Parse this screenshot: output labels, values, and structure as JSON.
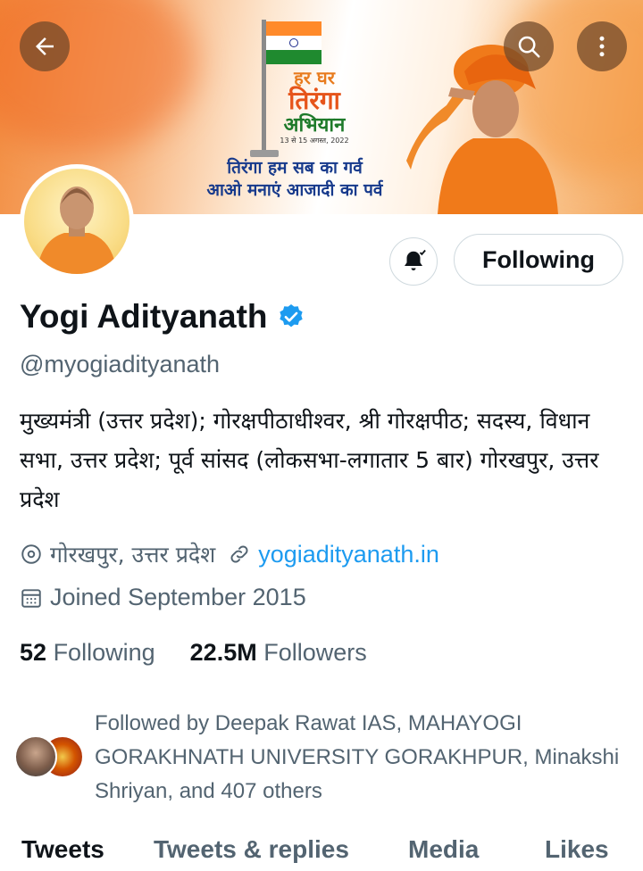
{
  "banner": {
    "campaign_line1": "हर घर",
    "campaign_line2": "तिरंगा",
    "campaign_line3": "अभियान",
    "campaign_dates": "13 से 15 अगस्त, 2022",
    "slogan_line1": "तिरंगा हम सब का गर्व",
    "slogan_line2": "आओ मनाएं आजादी का पर्व"
  },
  "header": {
    "back_icon": "arrow-left-icon",
    "search_icon": "search-icon",
    "more_icon": "more-vertical-icon"
  },
  "profile": {
    "name": "Yogi Adityanath",
    "handle": "@myogiadityanath",
    "bio": "मुख्यमंत्री (उत्तर प्रदेश); गोरक्षपीठाधीश्वर, श्री गोरक्षपीठ; सदस्य, विधान सभा, उत्तर प्रदेश; पूर्व सांसद (लोकसभा-लगातार 5 बार) गोरखपुर, उत्तर प्रदेश",
    "location": "गोरखपुर, उत्तर प्रदेश",
    "website": "yogiadityanath.in",
    "joined": "Joined September 2015",
    "following_count": "52",
    "following_label": "Following",
    "followers_count": "22.5M",
    "followers_label": "Followers"
  },
  "actions": {
    "follow_label": "Following",
    "notify_icon": "bell-icon"
  },
  "followed_by": {
    "text": "Followed by Deepak Rawat IAS, MAHAYOGI GORAKHNATH UNIVERSITY GORAKHPUR, Minakshi Shriyan, and 407 others"
  },
  "tabs": [
    "Tweets",
    "Tweets & replies",
    "Media",
    "Likes"
  ],
  "colors": {
    "accent": "#1d9bf0",
    "secondary_text": "#536471",
    "primary_text": "#0f1419",
    "border": "#cfd9de"
  }
}
